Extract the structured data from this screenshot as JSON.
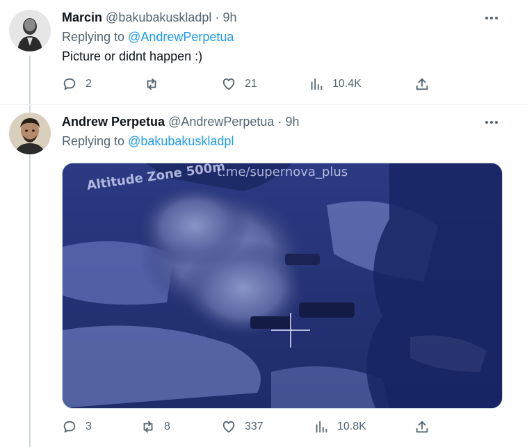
{
  "tweet1": {
    "name": "Marcin",
    "handle": "@bakubakuskladpl",
    "separator": "·",
    "time": "9h",
    "replying_prefix": "Replying to",
    "replying_to": "@AndrewPerpetua",
    "text": "Picture or didnt happen :)",
    "stats": {
      "replies": "2",
      "retweets": "",
      "likes": "21",
      "views": "10.4K"
    }
  },
  "tweet2": {
    "name": "Andrew Perpetua",
    "handle": "@AndrewPerpetua",
    "separator": "·",
    "time": "9h",
    "replying_prefix": "Replying to",
    "replying_to": "@bakubakuskladpl",
    "media": {
      "overlay_left": "Altitude Zone 500m",
      "overlay_right": "t.me/supernova_plus"
    },
    "stats": {
      "replies": "3",
      "retweets": "8",
      "likes": "337",
      "views": "10.8K"
    }
  },
  "colors": {
    "accent": "#1d9bf0",
    "secondary_text": "#536471",
    "primary_text": "#0f1419",
    "thread_line": "#cfd9de"
  },
  "icons": [
    "reply-icon",
    "retweet-icon",
    "like-icon",
    "views-icon",
    "share-icon",
    "more-icon"
  ]
}
